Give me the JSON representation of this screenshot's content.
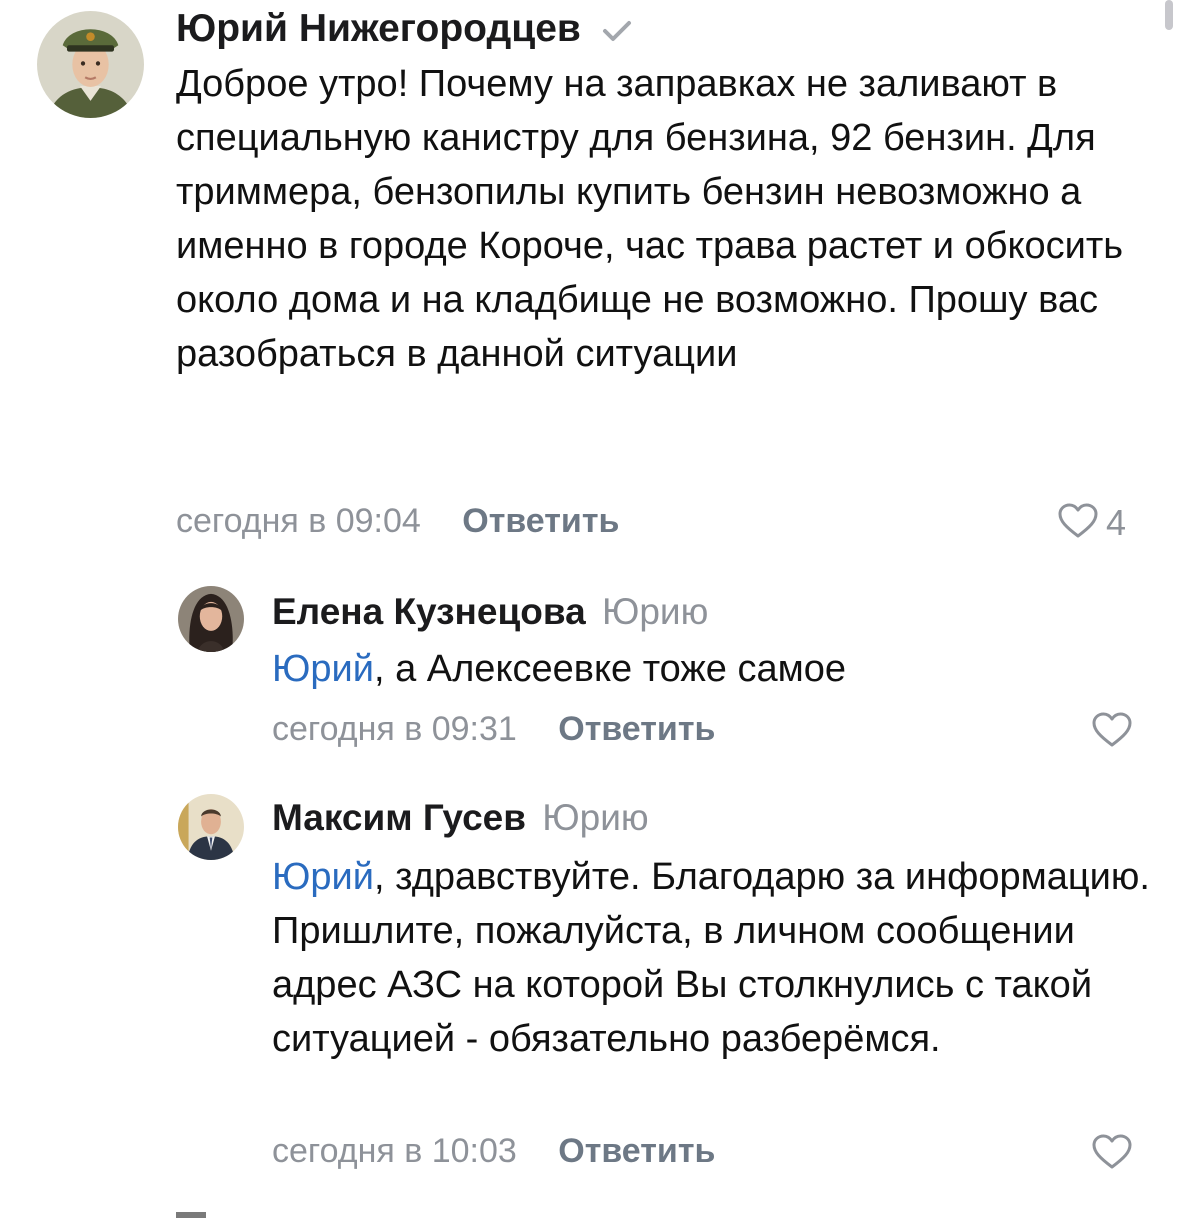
{
  "comments": [
    {
      "author": "Юрий Нижегородцев",
      "verified": true,
      "text": "Доброе утро! Почему на заправках не заливают в специальную канистру для бензина, 92 бензин. Для триммера, бензопилы купить бензин невозможно а именно в городе Короче, час трава растет и обкосить около дома и на кладбище не возможно. Прошу вас разобраться в данной ситуации",
      "time": "сегодня в 09:04",
      "reply_label": "Ответить",
      "likes": "4"
    },
    {
      "author": "Елена Кузнецова",
      "reply_to": "Юрию",
      "mention": "Юрий",
      "text": ", а Алексеевке тоже самое",
      "time": "сегодня в 09:31",
      "reply_label": "Ответить"
    },
    {
      "author": "Максим Гусев",
      "reply_to": "Юрию",
      "mention": "Юрий",
      "text": ", здравствуйте. Благодарю за информацию. Пришлите, пожалуйста, в личном сообщении адрес АЗС на которой Вы столкнулись с такой ситуацией - обязательно разберёмся.",
      "time": "сегодня в 10:03",
      "reply_label": "Ответить"
    }
  ],
  "colors": {
    "mention": "#2a6bbf",
    "secondary_text": "#8e9299",
    "reply_button": "#6d7885"
  },
  "icons": {
    "verified": "checkmark-icon",
    "like": "heart-outline-icon"
  }
}
